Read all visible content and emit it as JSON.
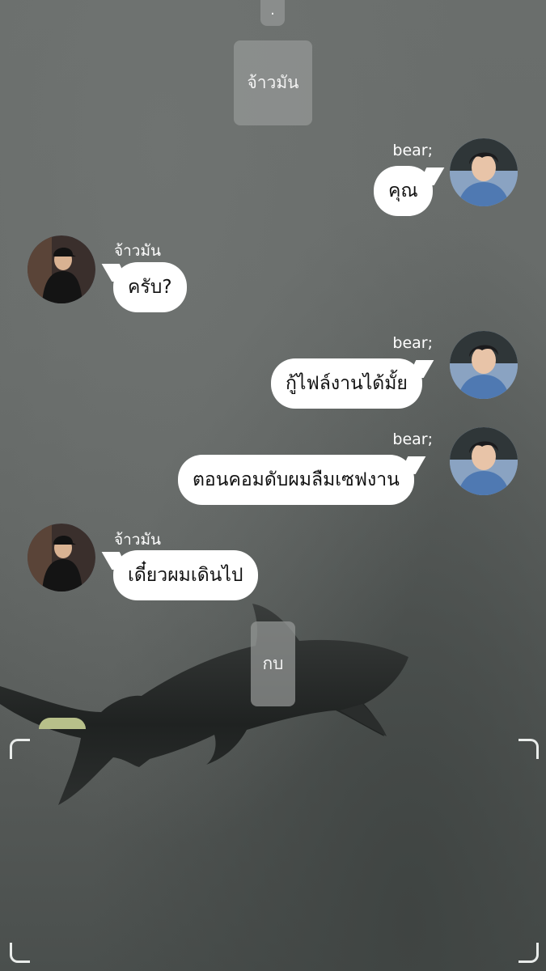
{
  "system_messages": [
    {
      "text": "."
    },
    {
      "text": "จ้าวมัน"
    },
    {
      "text": "กบ"
    }
  ],
  "messages": [
    {
      "sender": "bear;",
      "text": "คุณ",
      "side": "right"
    },
    {
      "sender": "จ้าวมัน",
      "text": "ครับ?",
      "side": "left"
    },
    {
      "sender": "bear;",
      "text": "กู้ไฟล์งานได้มั้ย",
      "side": "right"
    },
    {
      "sender": "bear;",
      "text": "ตอนคอมดับผมลืมเซฟงาน",
      "side": "right"
    },
    {
      "sender": "จ้าวมัน",
      "text": "เดี๋ยวผมเดินไป",
      "side": "left"
    }
  ],
  "colors": {
    "bubble": "#ffffff",
    "system_chip": "#969897",
    "background": "#646866"
  }
}
